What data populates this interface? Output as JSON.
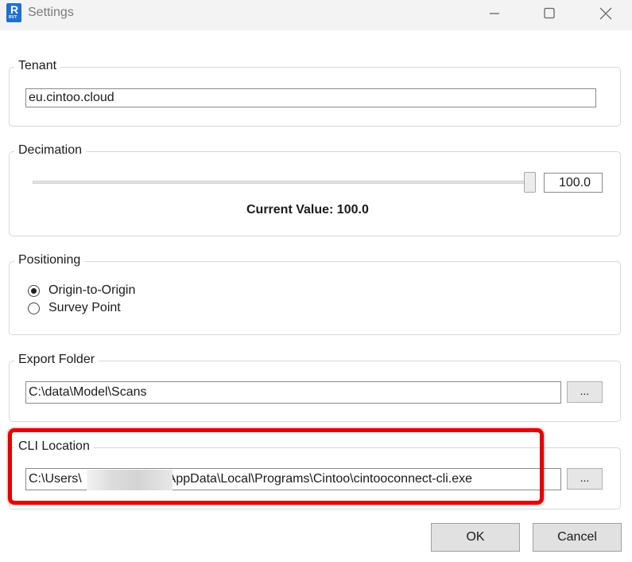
{
  "window": {
    "title": "Settings",
    "icon_letter": "R",
    "icon_sub": "RVT"
  },
  "tenant": {
    "label": "Tenant",
    "value": "eu.cintoo.cloud"
  },
  "decimation": {
    "label": "Decimation",
    "slider_value": "100.0",
    "slider_fraction": 1.0,
    "current_value_label": "Current Value: 100.0"
  },
  "positioning": {
    "label": "Positioning",
    "options": [
      "Origin-to-Origin",
      "Survey Point"
    ],
    "selected": "Origin-to-Origin"
  },
  "export_folder": {
    "label": "Export Folder",
    "value": "C:\\data\\Model\\Scans",
    "browse_label": "..."
  },
  "cli_location": {
    "label": "CLI Location",
    "value_prefix": "C:\\Users\\",
    "value_suffix": "AppData\\Local\\Programs\\Cintoo\\cintooconnect-cli.exe",
    "browse_label": "..."
  },
  "buttons": {
    "ok": "OK",
    "cancel": "Cancel"
  },
  "colors": {
    "highlight": "#e50000",
    "app_icon": "#1f6fd1"
  }
}
